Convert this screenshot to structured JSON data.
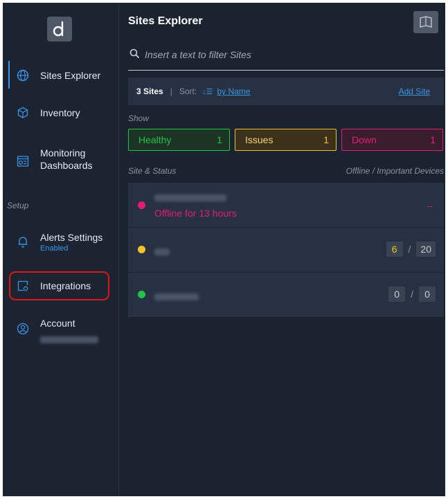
{
  "sidebar": {
    "logo_letter": "d",
    "items": [
      {
        "label": "Sites Explorer",
        "icon": "globe-icon"
      },
      {
        "label": "Inventory",
        "icon": "boxes-icon"
      },
      {
        "label": "Monitoring Dashboards",
        "icon": "dashboard-icon"
      }
    ],
    "setup_label": "Setup",
    "setup_items": [
      {
        "label": "Alerts Settings",
        "sub": "Enabled",
        "icon": "bell-icon"
      },
      {
        "label": "Integrations",
        "icon": "integrations-icon"
      },
      {
        "label": "Account",
        "icon": "account-icon"
      }
    ]
  },
  "header": {
    "title": "Sites Explorer"
  },
  "search": {
    "placeholder": "Insert a text to filter Sites"
  },
  "sites_bar": {
    "count": "3 Sites",
    "divider": "|",
    "sort_label": "Sort:",
    "sort_value": "by Name",
    "add_site": "Add Site"
  },
  "filters": {
    "show_label": "Show",
    "healthy": {
      "label": "Healthy",
      "count": "1"
    },
    "issues": {
      "label": "Issues",
      "count": "1"
    },
    "down": {
      "label": "Down",
      "count": "1"
    }
  },
  "table": {
    "col_site_status": "Site & Status",
    "col_devices": "Offline / Important Devices",
    "rows": [
      {
        "status": "down",
        "status_text": "Offline for 13 hours",
        "devices": "--"
      },
      {
        "status": "issues",
        "offline": "6",
        "important": "20"
      },
      {
        "status": "healthy",
        "offline": "0",
        "important": "0"
      }
    ]
  },
  "colors": {
    "healthy": "#21c34a",
    "issues": "#f3c12b",
    "down": "#e01d77",
    "accent": "#3b95e8",
    "highlight": "#e01515"
  }
}
